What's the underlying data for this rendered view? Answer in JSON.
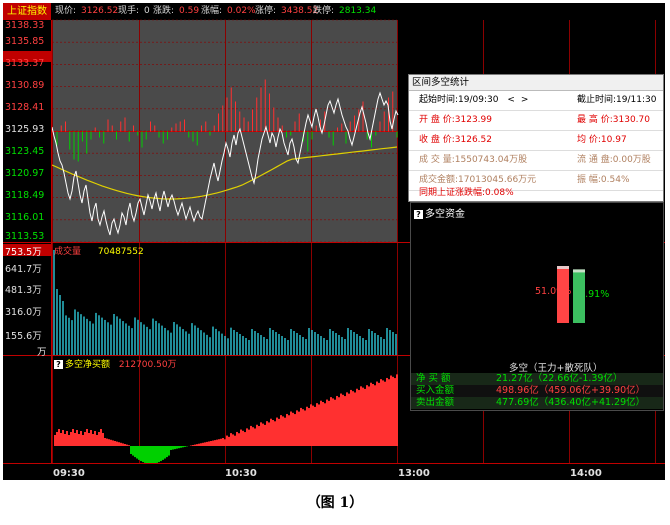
{
  "topbar": {
    "index_name": "上证指数",
    "price_label": "现价:",
    "price_value": "3126.52",
    "hand_label": "现手:",
    "hand_value": "0",
    "change_label": "涨跌:",
    "change_value": "0.59",
    "pct_label": "涨幅:",
    "pct_value": "0.02%",
    "limit_up_label": "涨停:",
    "limit_up_value": "3438.52",
    "limit_down_label": "跌停:",
    "limit_down_value": "2813.34"
  },
  "price_axis": [
    "3138.33",
    "3135.85",
    "3133.37",
    "3130.89",
    "3128.41",
    "3125.93",
    "3123.45",
    "3120.97",
    "3118.49",
    "3116.01",
    "3113.53"
  ],
  "volume_axis": [
    "753.5万",
    "641.7万",
    "481.3万",
    "316.0万",
    "155.6万",
    "万"
  ],
  "volume_title": "成交量",
  "volume_value": "70487552",
  "net_buy_title": "多空净买额",
  "net_buy_value": "212700.50万",
  "time_labels": [
    "09:30",
    "10:30",
    "13:00",
    "14:00"
  ],
  "stat": {
    "title": "区间多空统计",
    "start_label": "起始时间:",
    "start_value": "19/09:30",
    "end_label": "截止时间:",
    "end_value": "19/11:30",
    "open_label": "开 盘 价:",
    "open_value": "3123.99",
    "high_label": "最 高 价:",
    "high_value": "3130.70",
    "close_label": "收 盘 价:",
    "close_value": "3126.52",
    "avg_label": "均    价:",
    "avg_value": "10.97",
    "vol_label": "成 交 量:",
    "vol_value": "1550743.04万股",
    "float_label": "流 通 盘:",
    "float_value": "0.00万股",
    "amount_label": "成交金额:",
    "amount_value": "17013045.66万元",
    "swing_label": "振    幅:",
    "swing_value": "0.54%",
    "period_label": "同期上证涨跌幅:",
    "period_value": "0.08%"
  },
  "money": {
    "title": "多空资金",
    "bull_pct": "51.09%",
    "bear_pct": "48.91%",
    "bull_ratio": 0.5109,
    "bear_ratio": 0.4891,
    "category": "多空（王力+散死队）",
    "rows": [
      {
        "label": "净 买 额",
        "value": "21.27亿（22.66亿-1.39亿）",
        "color": "#00e000"
      },
      {
        "label": "买入金额",
        "value": "498.96亿（459.06亿+39.90亿）",
        "color": "#ff4040"
      },
      {
        "label": "卖出金额",
        "value": "477.69亿（436.40亿+41.29亿）",
        "color": "#00e000"
      }
    ]
  },
  "caption": "（图 1）",
  "colors": {
    "up": "#ff4040",
    "down": "#00d000",
    "price_line": "#ffffff",
    "avg_line": "#ffff00",
    "volume": "#00d0d0",
    "grid": "#8b0000",
    "chart_bg": "#4a4a4a"
  }
}
